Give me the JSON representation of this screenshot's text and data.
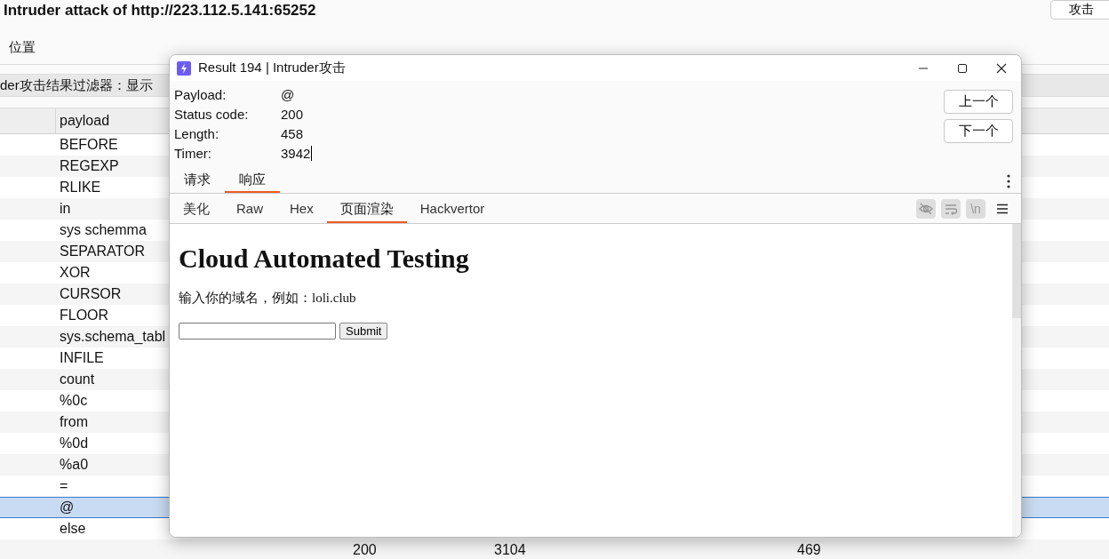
{
  "app": {
    "title": "Intruder attack of http://223.112.5.141:65252",
    "top_button": "攻击",
    "tabs": [
      {
        "label": "位置"
      }
    ],
    "filter": "der攻击结果过滤器：显示",
    "table": {
      "columns": [
        "payload"
      ],
      "rows": [
        {
          "payload": "BEFORE",
          "selected": false
        },
        {
          "payload": "REGEXP",
          "selected": false
        },
        {
          "payload": "RLIKE",
          "selected": false
        },
        {
          "payload": "in",
          "selected": false
        },
        {
          "payload": "sys schemma",
          "selected": false
        },
        {
          "payload": "SEPARATOR",
          "selected": false
        },
        {
          "payload": "XOR",
          "selected": false
        },
        {
          "payload": "CURSOR",
          "selected": false
        },
        {
          "payload": "FLOOR",
          "selected": false
        },
        {
          "payload": "sys.schema_tabl",
          "selected": false
        },
        {
          "payload": "INFILE",
          "selected": false
        },
        {
          "payload": "count",
          "selected": false
        },
        {
          "payload": "%0c",
          "selected": false
        },
        {
          "payload": "from",
          "selected": false
        },
        {
          "payload": "%0d",
          "selected": false
        },
        {
          "payload": "%a0",
          "selected": false
        },
        {
          "payload": "=",
          "selected": false
        },
        {
          "payload": "@",
          "selected": true
        },
        {
          "payload": "else",
          "selected": false
        },
        {
          "column_3": "200",
          "column_4": "3104",
          "column_5": "469",
          "selected": false
        }
      ]
    }
  },
  "dialog": {
    "title": "Result 194 | Intruder攻击",
    "fields": [
      {
        "label": "Payload:",
        "value": "@"
      },
      {
        "label": "Status code:",
        "value": "200"
      },
      {
        "label": "Length:",
        "value": "458"
      },
      {
        "label": "Timer:",
        "value": "3942"
      }
    ],
    "nav_buttons": [
      "上一个",
      "下一个"
    ],
    "tabs": [
      {
        "label": "请求",
        "selected": false
      },
      {
        "label": "响应",
        "selected": true
      }
    ],
    "view_tabs": [
      {
        "label": "美化",
        "selected": false
      },
      {
        "label": "Raw",
        "selected": false
      },
      {
        "label": "Hex",
        "selected": false
      },
      {
        "label": "页面渲染",
        "selected": true
      },
      {
        "label": "Hackvertor",
        "selected": false
      }
    ],
    "newline_toggle": "\\n",
    "render": {
      "heading": "Cloud Automated Testing",
      "text": "输入你的域名，例如：loli.club",
      "submit": "Submit"
    }
  }
}
